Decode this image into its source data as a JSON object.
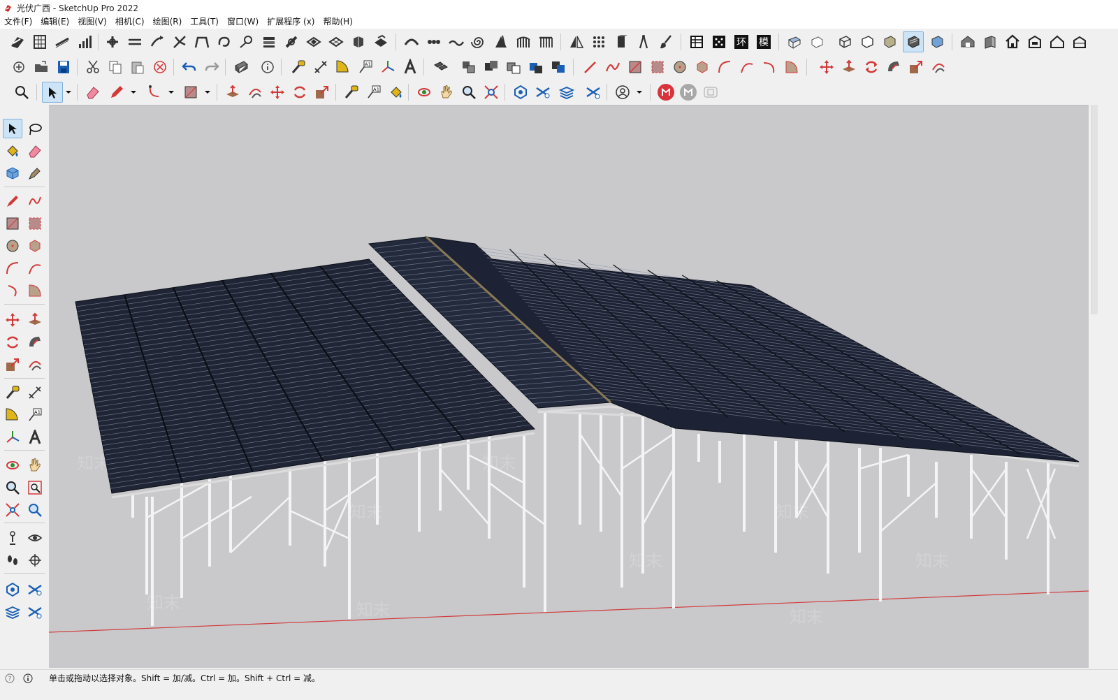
{
  "window": {
    "title": "光伏广西 - SketchUp Pro 2022"
  },
  "menu": [
    "文件(F)",
    "编辑(E)",
    "视图(V)",
    "相机(C)",
    "绘图(R)",
    "工具(T)",
    "窗口(W)",
    "扩展程序 (x)",
    "帮助(H)"
  ],
  "status": {
    "text": "单击或拖动以选择对象。Shift = 加/减。Ctrl = 加。Shift + Ctrl = 减。"
  },
  "watermark": {
    "text": "知末"
  },
  "colors": {
    "panel": "#1f2535",
    "panel_line": "#8a93a8",
    "steel": "#f2f2f2",
    "sky": "#c9c9cc",
    "axis_red": "#d23a3a",
    "accent_red": "#d8343b"
  }
}
